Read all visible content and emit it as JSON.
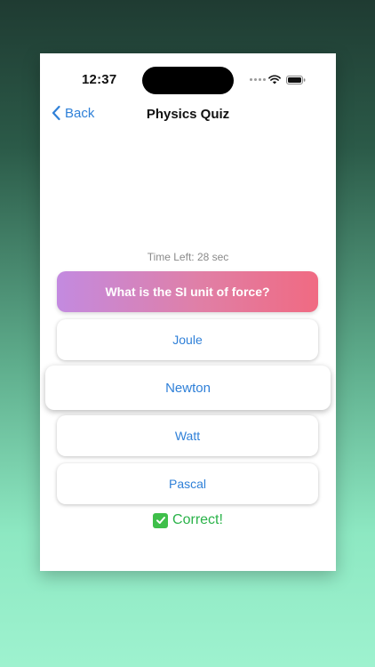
{
  "status_bar": {
    "time": "12:37"
  },
  "nav": {
    "back_label": "Back",
    "title": "Physics Quiz"
  },
  "quiz": {
    "timer_text": "Time Left: 28 sec",
    "question": "What is the SI unit of force?",
    "answers": [
      "Joule",
      "Newton",
      "Watt",
      "Pascal"
    ],
    "selected_answer": "Newton",
    "feedback": "Correct!"
  },
  "colors": {
    "accent": "#2f80d8",
    "correct": "#2bb34a",
    "question_gradient_start": "#c38ae0",
    "question_gradient_end": "#f06a82"
  },
  "icons": {
    "back": "chevron-left-icon",
    "wifi": "wifi-icon",
    "battery": "battery-icon",
    "feedback": "check-mark-icon"
  }
}
